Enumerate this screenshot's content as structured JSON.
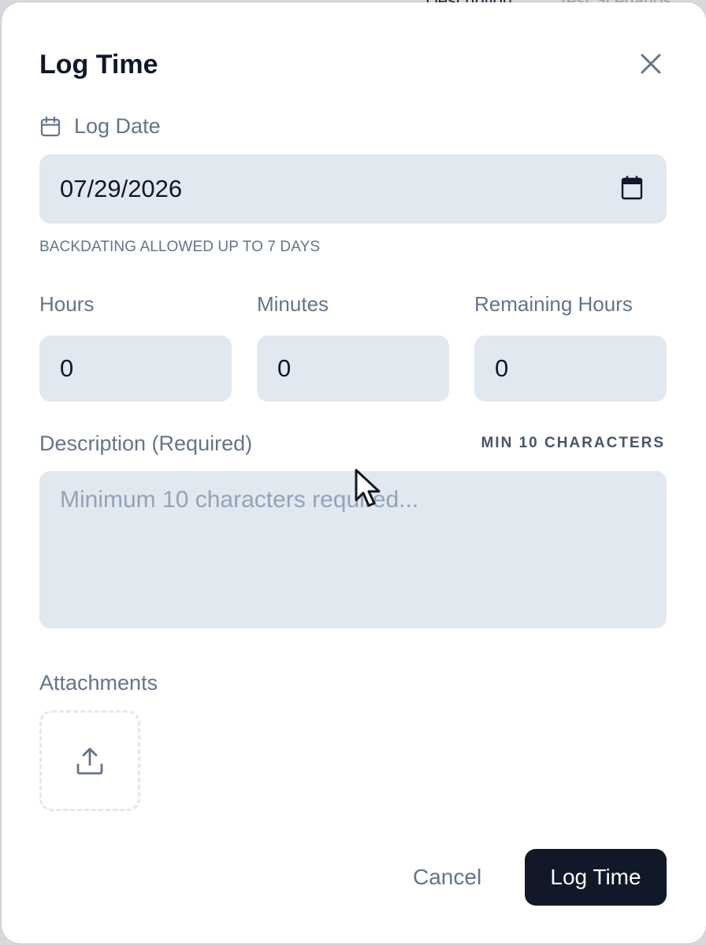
{
  "background": {
    "tabs": [
      "Description",
      "Test Scenarios"
    ]
  },
  "dialog": {
    "title": "Log Time",
    "close_icon": "close-icon"
  },
  "log_date": {
    "label": "Log Date",
    "icon": "calendar-icon",
    "value": "07/29/2026",
    "picker_icon": "calendar-picker-icon",
    "hint": "BACKDATING ALLOWED UP TO 7 DAYS"
  },
  "time": {
    "hours_label": "Hours",
    "hours_value": "0",
    "minutes_label": "Minutes",
    "minutes_value": "0",
    "remaining_label": "Remaining Hours",
    "remaining_value": "0"
  },
  "description": {
    "label": "Description (Required)",
    "requirement": "MIN 10 CHARACTERS",
    "placeholder": "Minimum 10 characters required...",
    "value": ""
  },
  "attachments": {
    "label": "Attachments",
    "upload_icon": "upload-icon"
  },
  "actions": {
    "cancel_label": "Cancel",
    "submit_label": "Log Time"
  },
  "colors": {
    "primary_button": "#111827",
    "field_bg": "#e2e8f0",
    "muted_text": "#64748b"
  }
}
